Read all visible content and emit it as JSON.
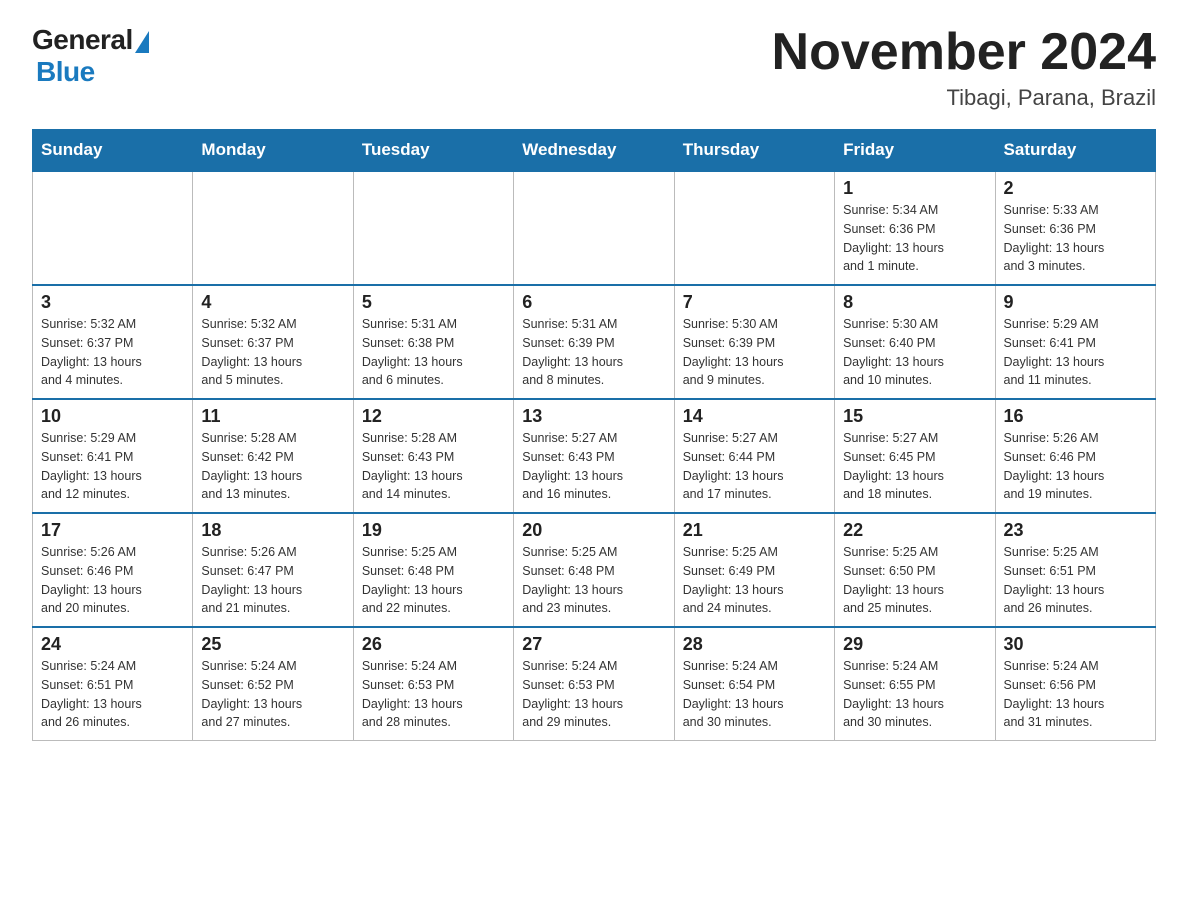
{
  "logo": {
    "general": "General",
    "blue": "Blue"
  },
  "header": {
    "month": "November 2024",
    "location": "Tibagi, Parana, Brazil"
  },
  "weekdays": [
    "Sunday",
    "Monday",
    "Tuesday",
    "Wednesday",
    "Thursday",
    "Friday",
    "Saturday"
  ],
  "weeks": [
    [
      {
        "day": "",
        "info": ""
      },
      {
        "day": "",
        "info": ""
      },
      {
        "day": "",
        "info": ""
      },
      {
        "day": "",
        "info": ""
      },
      {
        "day": "",
        "info": ""
      },
      {
        "day": "1",
        "info": "Sunrise: 5:34 AM\nSunset: 6:36 PM\nDaylight: 13 hours\nand 1 minute."
      },
      {
        "day": "2",
        "info": "Sunrise: 5:33 AM\nSunset: 6:36 PM\nDaylight: 13 hours\nand 3 minutes."
      }
    ],
    [
      {
        "day": "3",
        "info": "Sunrise: 5:32 AM\nSunset: 6:37 PM\nDaylight: 13 hours\nand 4 minutes."
      },
      {
        "day": "4",
        "info": "Sunrise: 5:32 AM\nSunset: 6:37 PM\nDaylight: 13 hours\nand 5 minutes."
      },
      {
        "day": "5",
        "info": "Sunrise: 5:31 AM\nSunset: 6:38 PM\nDaylight: 13 hours\nand 6 minutes."
      },
      {
        "day": "6",
        "info": "Sunrise: 5:31 AM\nSunset: 6:39 PM\nDaylight: 13 hours\nand 8 minutes."
      },
      {
        "day": "7",
        "info": "Sunrise: 5:30 AM\nSunset: 6:39 PM\nDaylight: 13 hours\nand 9 minutes."
      },
      {
        "day": "8",
        "info": "Sunrise: 5:30 AM\nSunset: 6:40 PM\nDaylight: 13 hours\nand 10 minutes."
      },
      {
        "day": "9",
        "info": "Sunrise: 5:29 AM\nSunset: 6:41 PM\nDaylight: 13 hours\nand 11 minutes."
      }
    ],
    [
      {
        "day": "10",
        "info": "Sunrise: 5:29 AM\nSunset: 6:41 PM\nDaylight: 13 hours\nand 12 minutes."
      },
      {
        "day": "11",
        "info": "Sunrise: 5:28 AM\nSunset: 6:42 PM\nDaylight: 13 hours\nand 13 minutes."
      },
      {
        "day": "12",
        "info": "Sunrise: 5:28 AM\nSunset: 6:43 PM\nDaylight: 13 hours\nand 14 minutes."
      },
      {
        "day": "13",
        "info": "Sunrise: 5:27 AM\nSunset: 6:43 PM\nDaylight: 13 hours\nand 16 minutes."
      },
      {
        "day": "14",
        "info": "Sunrise: 5:27 AM\nSunset: 6:44 PM\nDaylight: 13 hours\nand 17 minutes."
      },
      {
        "day": "15",
        "info": "Sunrise: 5:27 AM\nSunset: 6:45 PM\nDaylight: 13 hours\nand 18 minutes."
      },
      {
        "day": "16",
        "info": "Sunrise: 5:26 AM\nSunset: 6:46 PM\nDaylight: 13 hours\nand 19 minutes."
      }
    ],
    [
      {
        "day": "17",
        "info": "Sunrise: 5:26 AM\nSunset: 6:46 PM\nDaylight: 13 hours\nand 20 minutes."
      },
      {
        "day": "18",
        "info": "Sunrise: 5:26 AM\nSunset: 6:47 PM\nDaylight: 13 hours\nand 21 minutes."
      },
      {
        "day": "19",
        "info": "Sunrise: 5:25 AM\nSunset: 6:48 PM\nDaylight: 13 hours\nand 22 minutes."
      },
      {
        "day": "20",
        "info": "Sunrise: 5:25 AM\nSunset: 6:48 PM\nDaylight: 13 hours\nand 23 minutes."
      },
      {
        "day": "21",
        "info": "Sunrise: 5:25 AM\nSunset: 6:49 PM\nDaylight: 13 hours\nand 24 minutes."
      },
      {
        "day": "22",
        "info": "Sunrise: 5:25 AM\nSunset: 6:50 PM\nDaylight: 13 hours\nand 25 minutes."
      },
      {
        "day": "23",
        "info": "Sunrise: 5:25 AM\nSunset: 6:51 PM\nDaylight: 13 hours\nand 26 minutes."
      }
    ],
    [
      {
        "day": "24",
        "info": "Sunrise: 5:24 AM\nSunset: 6:51 PM\nDaylight: 13 hours\nand 26 minutes."
      },
      {
        "day": "25",
        "info": "Sunrise: 5:24 AM\nSunset: 6:52 PM\nDaylight: 13 hours\nand 27 minutes."
      },
      {
        "day": "26",
        "info": "Sunrise: 5:24 AM\nSunset: 6:53 PM\nDaylight: 13 hours\nand 28 minutes."
      },
      {
        "day": "27",
        "info": "Sunrise: 5:24 AM\nSunset: 6:53 PM\nDaylight: 13 hours\nand 29 minutes."
      },
      {
        "day": "28",
        "info": "Sunrise: 5:24 AM\nSunset: 6:54 PM\nDaylight: 13 hours\nand 30 minutes."
      },
      {
        "day": "29",
        "info": "Sunrise: 5:24 AM\nSunset: 6:55 PM\nDaylight: 13 hours\nand 30 minutes."
      },
      {
        "day": "30",
        "info": "Sunrise: 5:24 AM\nSunset: 6:56 PM\nDaylight: 13 hours\nand 31 minutes."
      }
    ]
  ]
}
